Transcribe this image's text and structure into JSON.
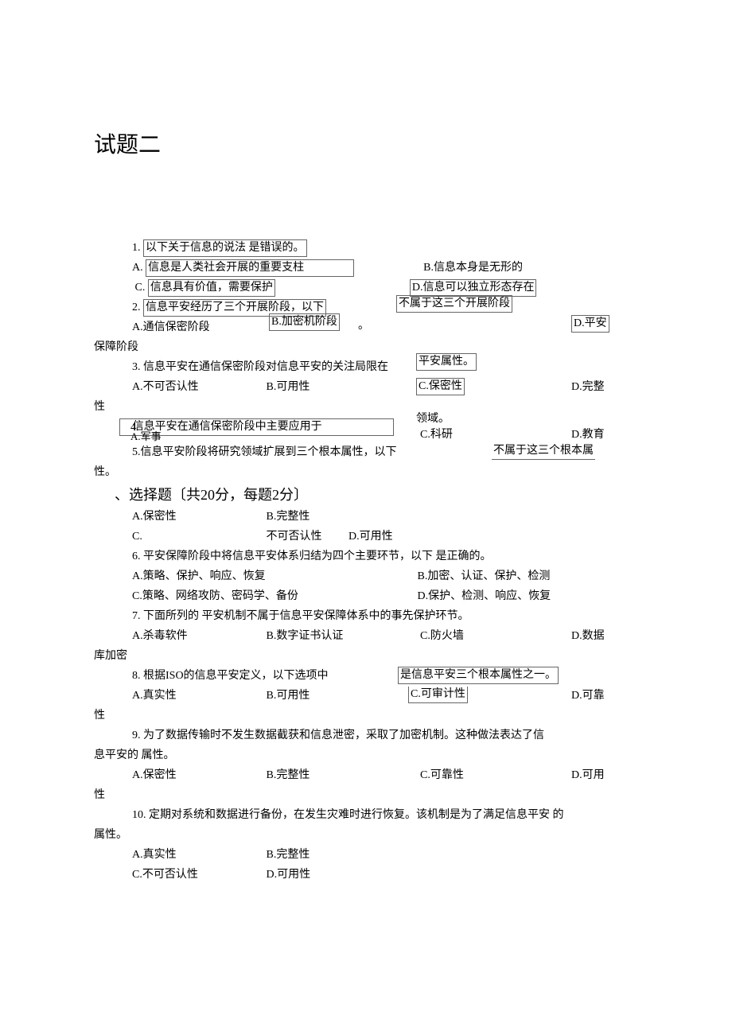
{
  "title": "试题二",
  "section_heading": "、选择题〔共20分，每题2分〕",
  "q1": {
    "num": "1.",
    "stem_box": "以下关于信息的说法  是错误的。",
    "a_label": "A.",
    "a_box": "信息是人类社会开展的重要支柱",
    "b": "B.信息本身是无形的",
    "c_label": "C.",
    "c_box": "信息具有价值，需要保护",
    "d_box": "D.信息可以独立形态存在"
  },
  "q2": {
    "num": "2.",
    "stem_box": "信息平安经历了三个开展阶段，以下",
    "stem_tail_box": "不属于这三个开展阶段",
    "stem_dot": "。",
    "a": "A.通信保密阶段",
    "b_box": "B.加密机阶段",
    "d_box": "D.平安",
    "cont": "保障阶段"
  },
  "q3": {
    "num": "3. ",
    "stem": "信息平安在通信保密阶段对信息平安的关注局限在",
    "tail_box": "平安属性。",
    "a": "A.不可否认性",
    "b": "B.可用性",
    "c_box": "C.保密性",
    "d": "D.完整",
    "cont": "性"
  },
  "q4": {
    "num": "4. ",
    "stem_box": "信息平安在通信保密阶段中主要应用于",
    "a_line": "A.军事",
    "tail": "领域。",
    "c": "C.科研",
    "d": "D.教育"
  },
  "q5": {
    "num": "5.",
    "stem": "信息平安阶段将研究领域扩展到三个根本属性，以下",
    "tail_box": "不属于这三个根本属",
    "cont": "性。",
    "a": "A.保密性",
    "b": "B.完整性",
    "c": "C.",
    "c2": "不可否认性",
    "d": "D.可用性"
  },
  "q6": {
    "num": "6. ",
    "stem": "平安保障阶段中将信息平安体系归结为四个主要环节，以下  是正确的。",
    "a": "A.策略、保护、响应、恢复",
    "b": "B.加密、认证、保护、检测",
    "c": "C.策略、网络攻防、密码学、备份",
    "d": "D.保护、检测、响应、恢复"
  },
  "q7": {
    "num": "7. ",
    "stem": "下面所列的   平安机制不属于信息平安保障体系中的事先保护环节。",
    "a": "A.杀毒软件",
    "b": "B.数字证书认证",
    "c": "C.防火墙",
    "d": "D.数据",
    "cont": "库加密"
  },
  "q8": {
    "num": "8. ",
    "stem": "  根据ISO的信息平安定义，以下选项中",
    "tail_box": "是信息平安三个根本属性之一。",
    "a": "A.真实性",
    "b": "B.可用性",
    "c": "C.可审计性",
    "d": "D.可靠",
    "cont": "性"
  },
  "q9": {
    "num": "9. ",
    "stem": "  为了数据传输时不发生数据截获和信息泄密，采取了加密机制。这种做法表达了信",
    "cont": "息平安的  属性。",
    "a": "A.保密性",
    "b": "B.完整性",
    "c": "C.可靠性",
    "d": "D.可用",
    "cont2": "性"
  },
  "q10": {
    "num": "10. ",
    "stem": "  定期对系统和数据进行备份，在发生灾难时进行恢复。该机制是为了满足信息平安  的",
    "cont": "属性。",
    "a": "A.真实性",
    "b": "B.完整性",
    "c": "C.不可否认性",
    "d": "D.可用性"
  }
}
